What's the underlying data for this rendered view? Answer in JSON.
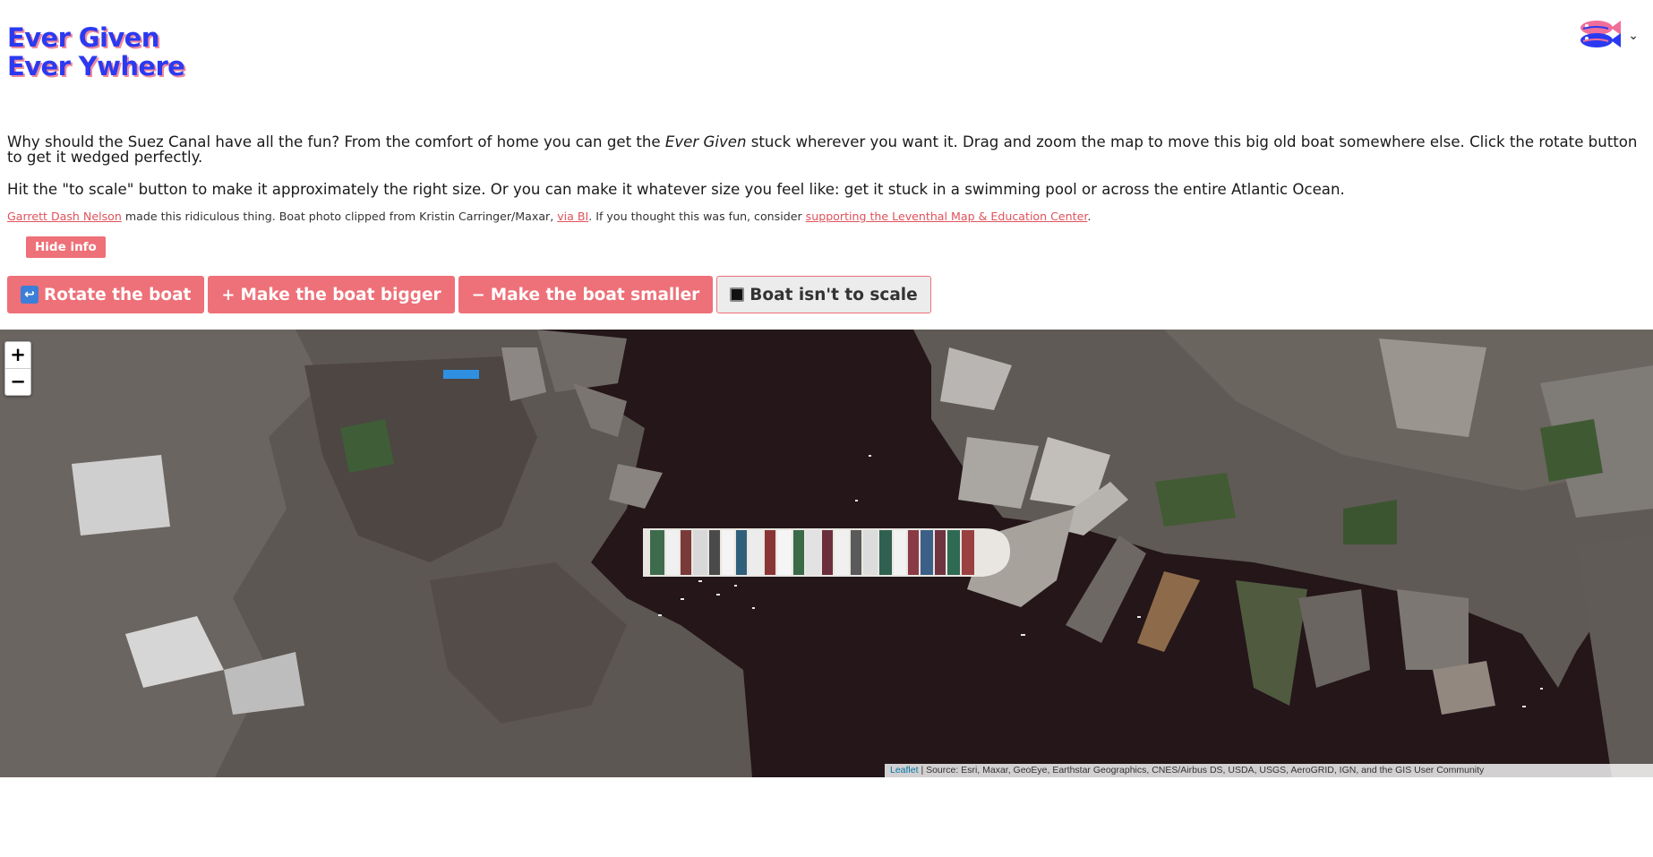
{
  "header": {
    "title_line1": "Ever Given",
    "title_line2": "Ever Ywhere",
    "logo_icon": "fish-logo-icon",
    "menu_chevron": "⌄"
  },
  "intro": {
    "p1_before": "Why should the Suez Canal have all the fun? From the comfort of home you can get the ",
    "p1_emphasis": "Ever Given",
    "p1_after": " stuck wherever you want it. Drag and zoom the map to move this big old boat somewhere else. Click the rotate button to get it wedged perfectly.",
    "p2": "Hit the \"to scale\" button to make it approximately the right size. Or you can make it whatever size you feel like: get it stuck in a swimming pool or across the entire Atlantic Ocean."
  },
  "credits": {
    "author_link": "Garrett Dash Nelson",
    "text1": " made this ridiculous thing. Boat photo clipped from Kristin Carringer/Maxar, ",
    "via_link": "via BI",
    "text2": ". If you thought this was fun, consider ",
    "support_link": "supporting the Leventhal Map & Education Center",
    "text3": "."
  },
  "buttons": {
    "hide_info": "Hide info",
    "rotate_icon": "↩",
    "rotate": "Rotate the boat",
    "bigger_icon": "+",
    "bigger": "Make the boat bigger",
    "smaller_icon": "−",
    "smaller": "Make the boat smaller",
    "scale": "Boat isn't to scale"
  },
  "map": {
    "zoom_in": "+",
    "zoom_out": "−",
    "attribution_link": "Leaflet",
    "attribution_text": " | Source: Esri, Maxar, GeoEye, Earthstar Geographics, CNES/Airbus DS, USDA, USGS, AeroGRID, IGN, and the GIS User Community"
  },
  "colors": {
    "accent": "#ee7078",
    "title": "#2b3af0",
    "water": "#241619"
  }
}
